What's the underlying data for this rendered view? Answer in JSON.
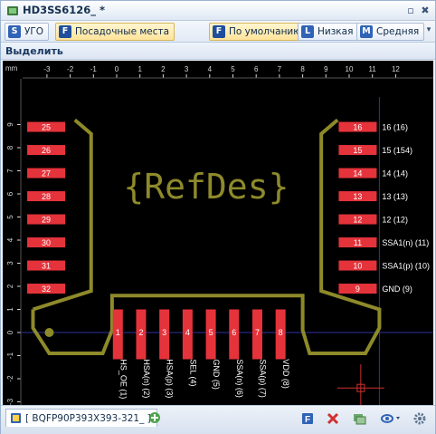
{
  "window": {
    "title": "HD3SS6126_ *",
    "pin_label": "\u0002",
    "close_label": "✖"
  },
  "toolbar": {
    "items": [
      {
        "badge": "S",
        "label": "УГО",
        "active": false
      },
      {
        "badge": "F",
        "label": "Посадочные места",
        "active": true
      },
      {
        "badge": "F",
        "label": "По умолчанию",
        "active": true
      },
      {
        "badge": "L",
        "label": "Низкая",
        "active": false
      },
      {
        "badge": "M",
        "label": "Средняя",
        "active": false
      }
    ],
    "more_label": "▾"
  },
  "section": {
    "label": "Выделить"
  },
  "ruler": {
    "unit": "mm",
    "x_ticks": [
      "-3",
      "-2",
      "-1",
      "0",
      "1",
      "2",
      "3",
      "4",
      "5",
      "6",
      "7",
      "8",
      "9",
      "10",
      "11",
      "12"
    ],
    "y_ticks": [
      "9",
      "8",
      "7",
      "6",
      "5",
      "4",
      "3",
      "2",
      "1",
      "0",
      "-1",
      "-2",
      "-3"
    ]
  },
  "footprint": {
    "refdes": "{RefDes}",
    "left_pads": [
      "25",
      "26",
      "27",
      "28",
      "29",
      "30",
      "31",
      "32"
    ],
    "right_pads": [
      {
        "num": "16",
        "net": "16 (16)"
      },
      {
        "num": "15",
        "net": "15 (154)"
      },
      {
        "num": "14",
        "net": "14 (14)"
      },
      {
        "num": "13",
        "net": "13 (13)"
      },
      {
        "num": "12",
        "net": "12 (12)"
      },
      {
        "num": "11",
        "net": "SSA1(n) (11)"
      },
      {
        "num": "10",
        "net": "SSA1(p) (10)"
      },
      {
        "num": "9",
        "net": "GND (9)"
      }
    ],
    "bottom_pads": [
      {
        "num": "1",
        "net": "HS_OE (1)"
      },
      {
        "num": "2",
        "net": "HSA(n) (2)"
      },
      {
        "num": "3",
        "net": "HSA(p) (3)"
      },
      {
        "num": "4",
        "net": "SEL (4)"
      },
      {
        "num": "5",
        "net": "GND (5)"
      },
      {
        "num": "6",
        "net": "SSA(n) (6)"
      },
      {
        "num": "7",
        "net": "SSA(p) (7)"
      },
      {
        "num": "8",
        "net": "VDD (8)"
      }
    ]
  },
  "colors": {
    "pad": "#e5333b",
    "outline": "#8e8a2a",
    "ruler_text": "#d8d8d8",
    "grid_axis": "#2c34a0"
  },
  "bottombar": {
    "tab_label": "[ BQFP90P393X393-321_ ]",
    "icons": [
      "new-tab-icon",
      "footprint-icon",
      "delete-icon",
      "layers-icon",
      "view-dropdown-icon",
      "settings-icon"
    ]
  }
}
